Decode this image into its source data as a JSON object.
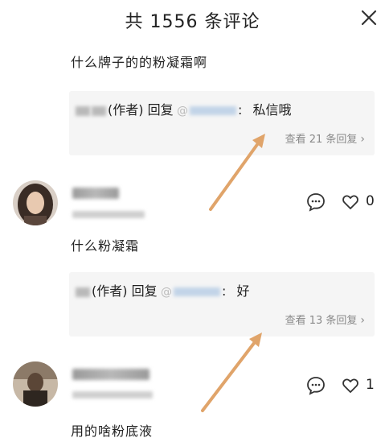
{
  "header": {
    "title": "共 1556 条评论"
  },
  "comments": [
    {
      "text": "什么牌子的的粉凝霜啊",
      "reply": {
        "author_role": "(作者) 回复",
        "colon": ":",
        "text": "私信哦",
        "view_more": "查看 21 条回复"
      }
    },
    {
      "likes": "0",
      "text": "什么粉凝霜",
      "reply": {
        "author_role": "(作者) 回复",
        "colon": ":",
        "text": "好",
        "view_more": "查看 13 条回复"
      }
    },
    {
      "likes": "1",
      "text": "用的啥粉底液"
    }
  ],
  "icons": {
    "close": "close-icon",
    "reply": "comment-bubble-icon",
    "like": "heart-icon",
    "chevron": "chevron-right-icon"
  },
  "colors": {
    "arrow": "#e0a46a",
    "reply_bg": "#f5f5f5",
    "link": "#8a8a8a"
  }
}
